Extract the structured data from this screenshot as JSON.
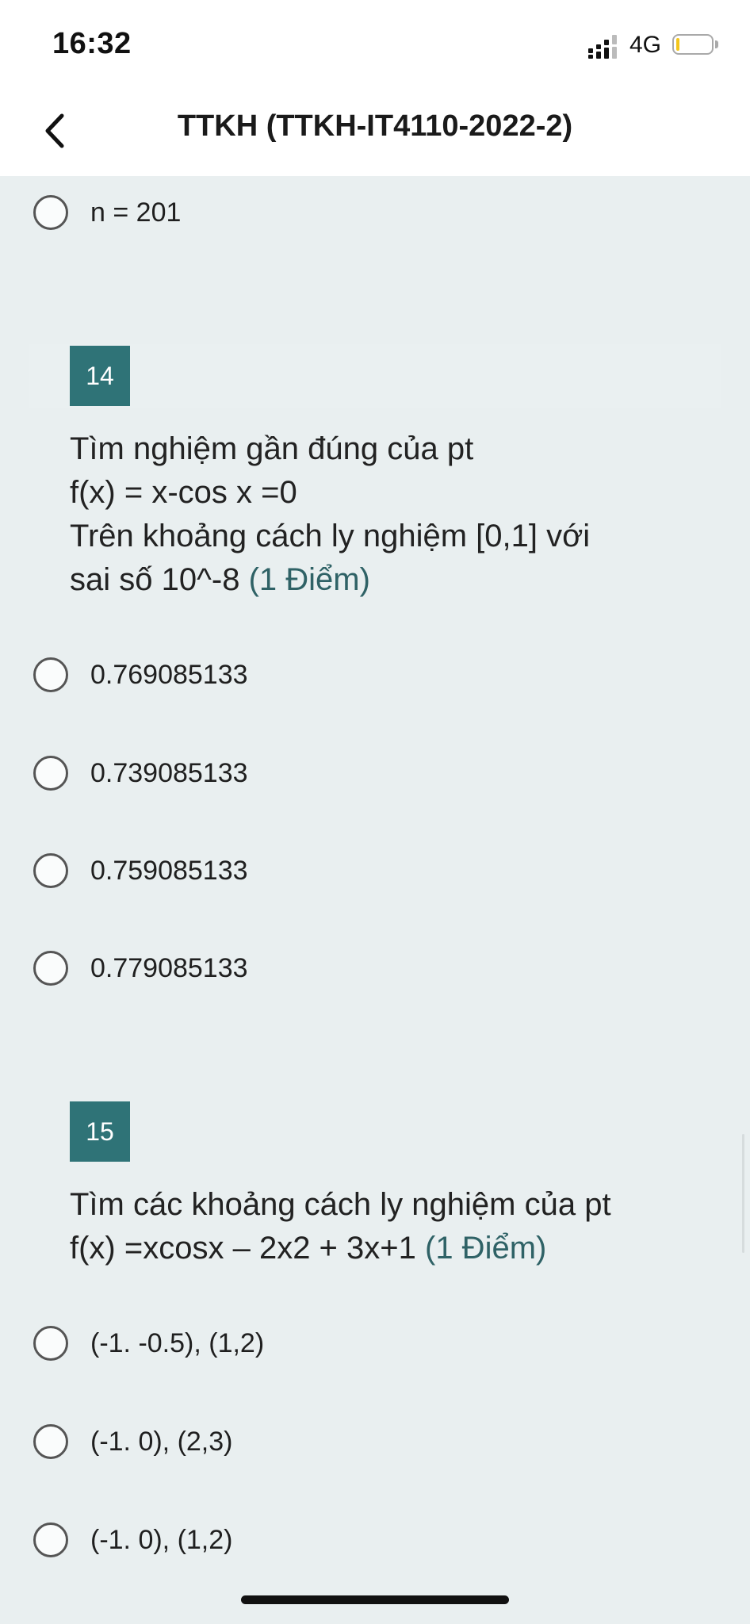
{
  "status_bar": {
    "time": "16:32",
    "network": "4G",
    "battery_level": 0.1,
    "signal_icon": "signal-bars-icon"
  },
  "header": {
    "title": "TTKH (TTKH-IT4110-2022-2)",
    "back_icon": "chevron-left-icon"
  },
  "previous_option": {
    "label": "n = 201"
  },
  "questions": [
    {
      "number": "14",
      "lines": [
        "Tìm nghiệm gần đúng của pt",
        "f(x) = x-cos x =0",
        "Trên khoảng cách ly nghiệm [0,1] với",
        "sai số 10^-8"
      ],
      "points": "(1 Điểm)",
      "options": [
        "0.769085133",
        "0.739085133",
        "0.759085133",
        "0.779085133"
      ]
    },
    {
      "number": "15",
      "lines": [
        "Tìm các khoảng cách ly nghiệm của pt",
        "f(x) =xcosx – 2x2 + 3x+1"
      ],
      "points": "(1 Điểm)",
      "options": [
        "(-1. -0.5), (1,2)",
        "(-1. 0), (2,3)",
        "(-1. 0), (1,2)"
      ]
    }
  ],
  "colors": {
    "accent": "#2f7377",
    "points_text": "#2f6266",
    "background": "#e9eff0"
  }
}
